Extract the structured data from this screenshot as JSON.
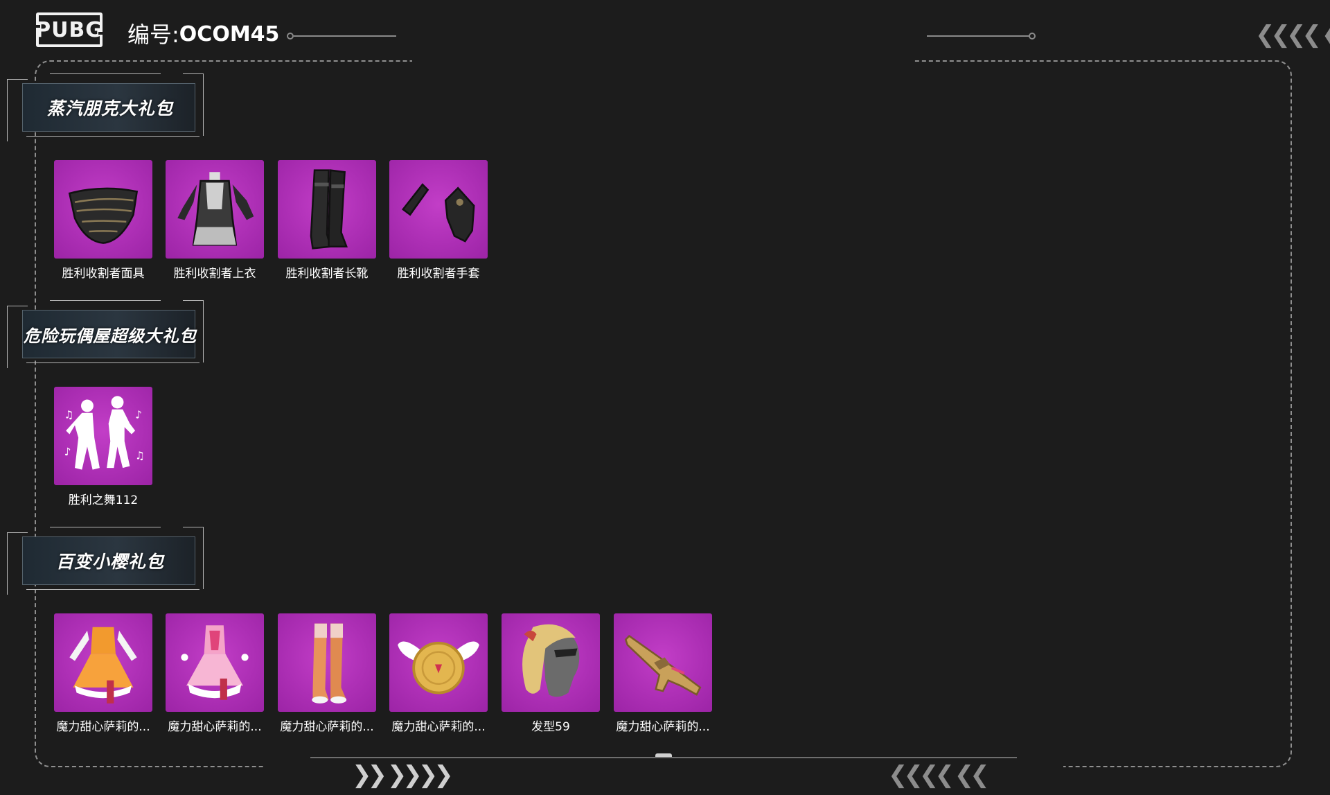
{
  "header": {
    "logo_text": "PUBG",
    "code_label": "编号:",
    "code_value": "OCOM45"
  },
  "sections": [
    {
      "title": "蒸汽朋克大礼包",
      "items": [
        {
          "label": "胜利收割者面具",
          "icon": "mask-icon"
        },
        {
          "label": "胜利收割者上衣",
          "icon": "armor-top-icon"
        },
        {
          "label": "胜利收割者长靴",
          "icon": "boots-icon"
        },
        {
          "label": "胜利收割者手套",
          "icon": "gloves-icon"
        }
      ]
    },
    {
      "title": "危险玩偶屋超级大礼包",
      "items": [
        {
          "label": "胜利之舞112",
          "icon": "dance-emote-icon"
        }
      ]
    },
    {
      "title": "百变小樱礼包",
      "items": [
        {
          "label": "魔力甜心萨莉的...",
          "icon": "dress-orange-icon"
        },
        {
          "label": "魔力甜心萨莉的...",
          "icon": "dress-pink-icon"
        },
        {
          "label": "魔力甜心萨莉的...",
          "icon": "stockings-icon"
        },
        {
          "label": "魔力甜心萨莉的...",
          "icon": "winged-backpack-icon"
        },
        {
          "label": "发型59",
          "icon": "hairstyle-icon"
        },
        {
          "label": "魔力甜心萨莉的...",
          "icon": "rifle-icon"
        }
      ]
    }
  ],
  "colors": {
    "background": "#1c1c1c",
    "tile": "#ad2fb5",
    "frame": "#8f8f8f"
  }
}
